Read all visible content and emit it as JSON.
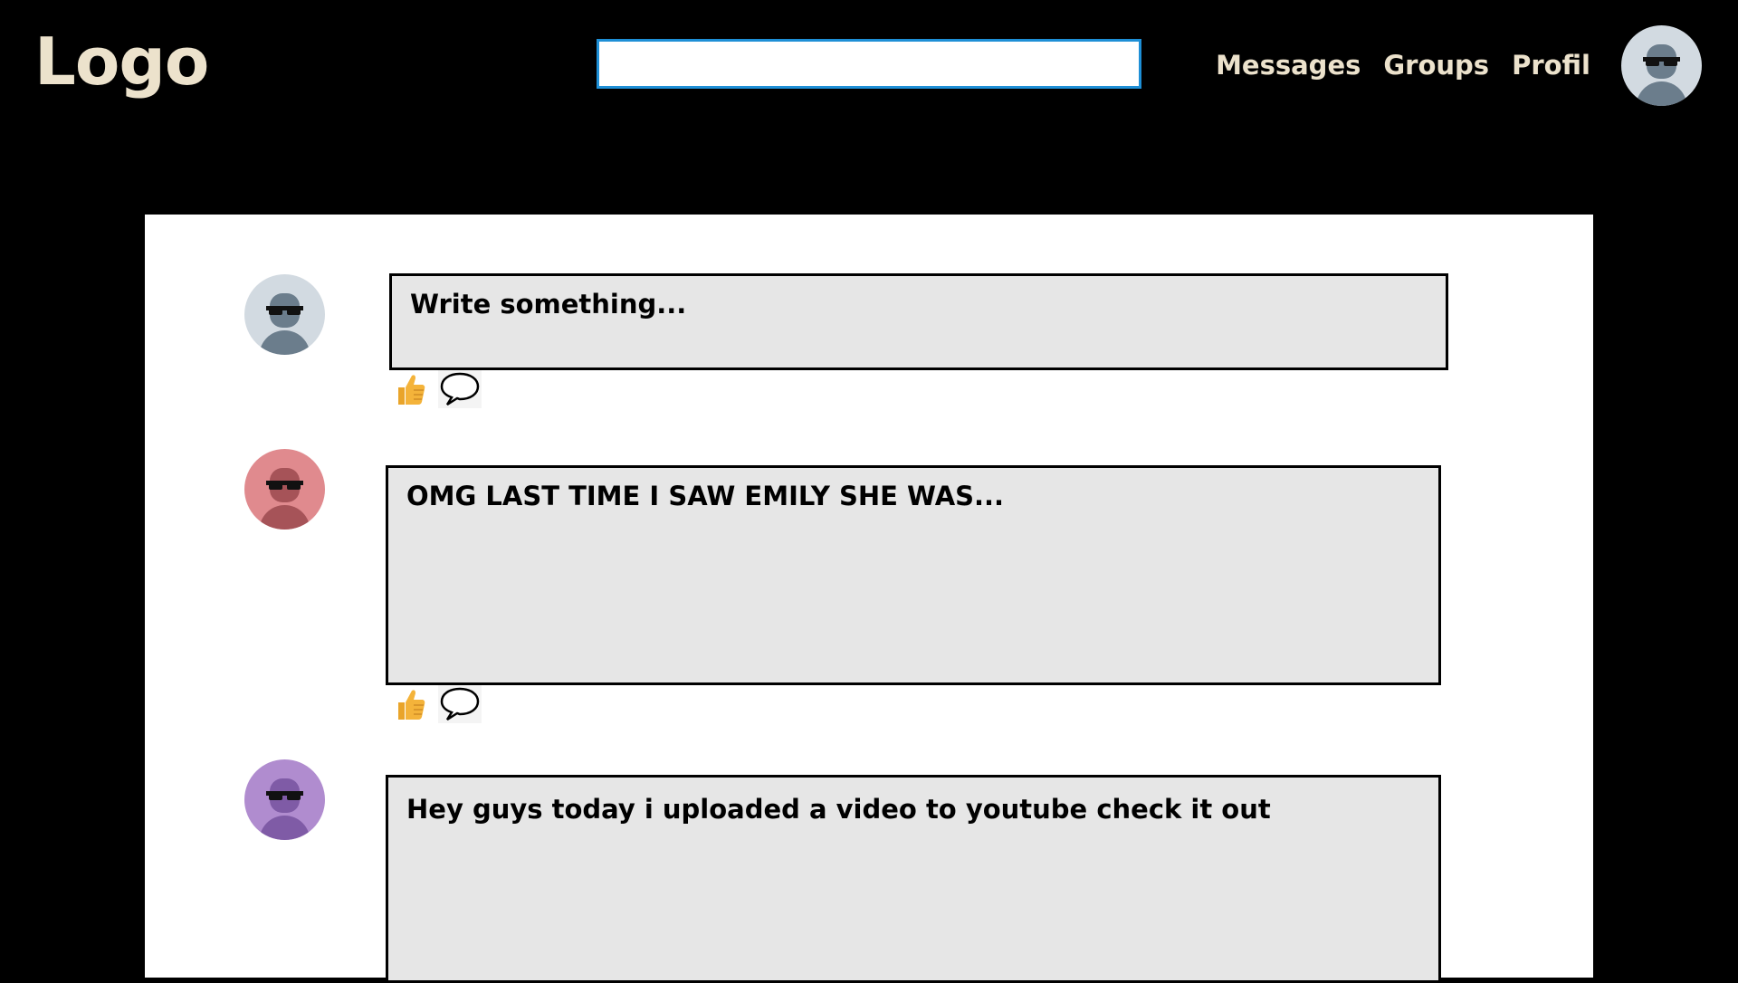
{
  "header": {
    "logo": "Logo",
    "search": {
      "value": "",
      "placeholder": ""
    },
    "nav": [
      {
        "label": "Messages"
      },
      {
        "label": "Groups"
      },
      {
        "label": "Profil"
      }
    ],
    "avatar": {
      "icon": "user-avatar-icon",
      "bg_color": "#d2dae1",
      "figure_color": "#6b7d8c"
    }
  },
  "composer": {
    "placeholder": "Write something...",
    "avatar": {
      "icon": "user-avatar-icon",
      "bg_color": "#d2dae1",
      "figure_color": "#6b7d8c"
    },
    "actions": {
      "like_icon": "thumbs-up-icon",
      "comment_icon": "speech-bubble-icon"
    }
  },
  "posts": [
    {
      "text": "OMG LAST TIME I SAW EMILY SHE WAS...",
      "avatar": {
        "icon": "user-avatar-icon",
        "bg_color": "#e08a8e",
        "figure_color": "#a65358"
      },
      "actions": {
        "like_icon": "thumbs-up-icon",
        "comment_icon": "speech-bubble-icon"
      }
    },
    {
      "text": "Hey guys today i uploaded a video to youtube check it out",
      "avatar": {
        "icon": "user-avatar-icon",
        "bg_color": "#b08ccf",
        "figure_color": "#7f5ba6"
      }
    }
  ],
  "colors": {
    "background": "#000000",
    "header_text": "#ece2cc",
    "search_border": "#1e8fd6",
    "panel": "#ffffff",
    "post_box": "#e6e6e6",
    "like": "#f4b33a"
  }
}
